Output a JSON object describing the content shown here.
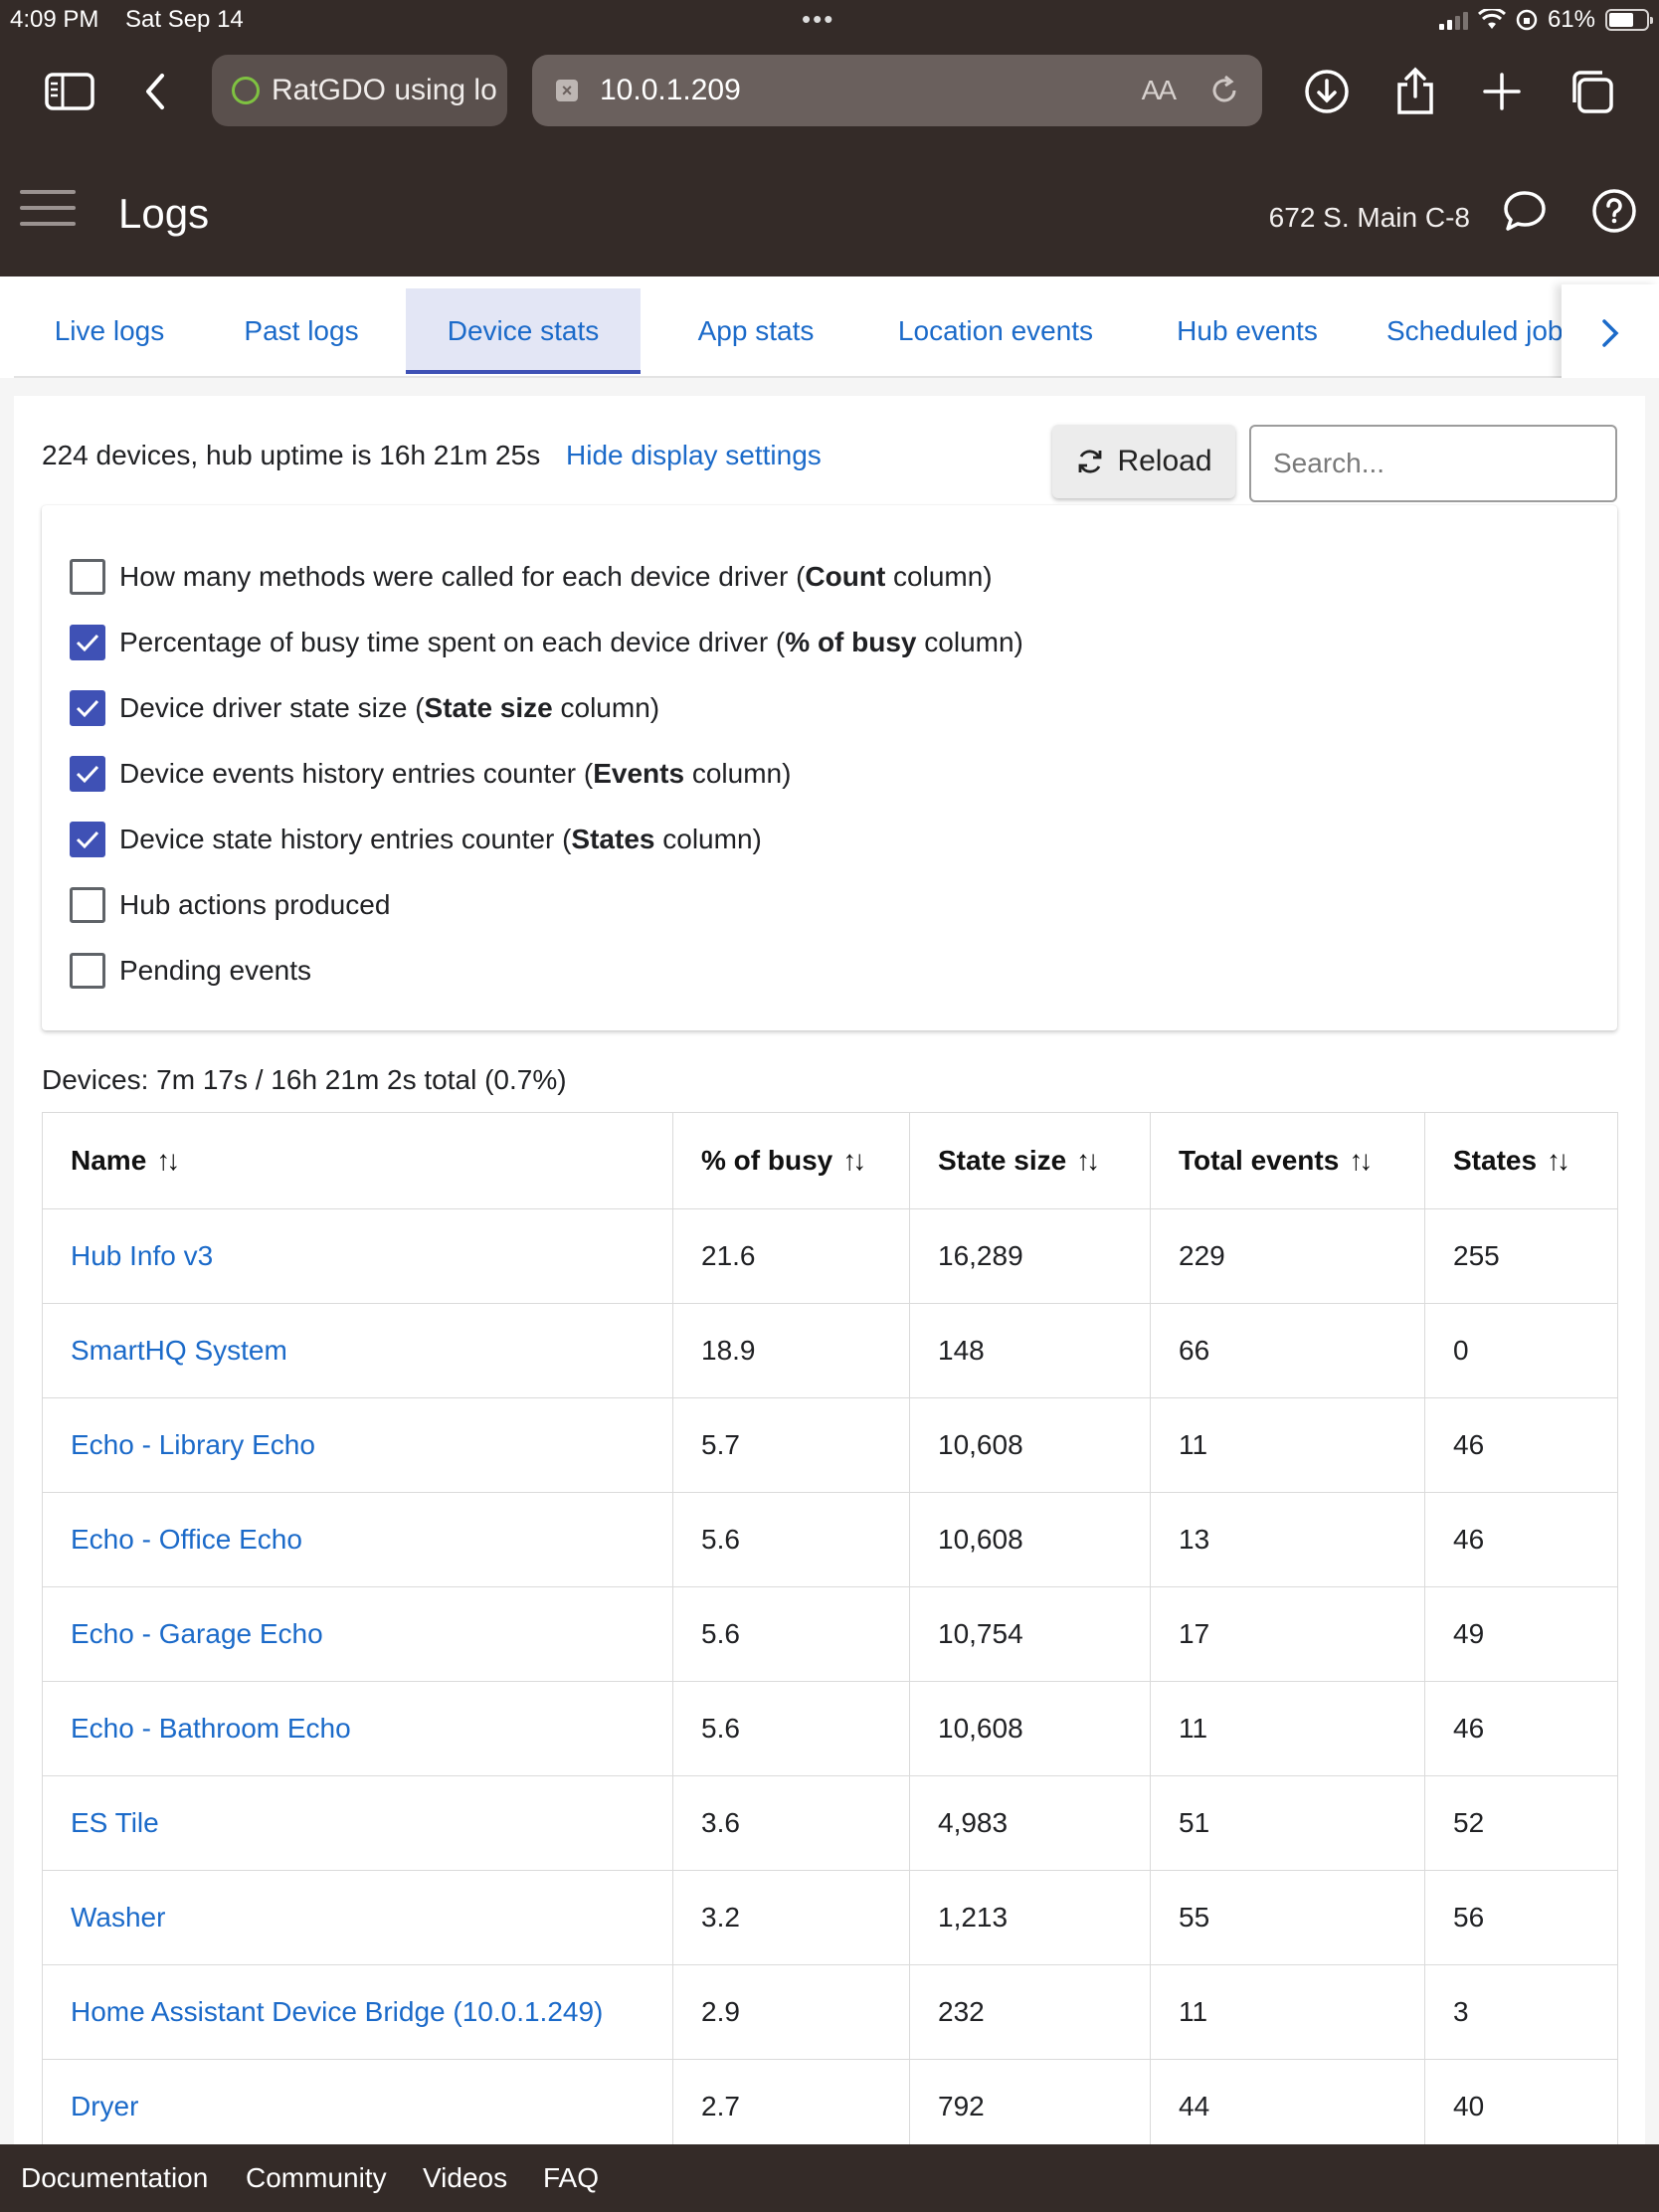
{
  "status_bar": {
    "time": "4:09 PM",
    "date": "Sat Sep 14",
    "battery": "61%"
  },
  "browser": {
    "tab_title": "RatGDO using lo",
    "url": "10.0.1.209",
    "reader_label": "AA"
  },
  "header": {
    "title": "Logs",
    "location": "672 S. Main C-8"
  },
  "tabs": [
    {
      "label": "Live logs"
    },
    {
      "label": "Past logs"
    },
    {
      "label": "Device stats",
      "active": true
    },
    {
      "label": "App stats"
    },
    {
      "label": "Location events"
    },
    {
      "label": "Hub events"
    },
    {
      "label": "Scheduled job"
    }
  ],
  "toolbar": {
    "summary": "224 devices, hub uptime is 16h 21m 25s",
    "hide_settings": "Hide display settings",
    "reload_label": "Reload",
    "search_placeholder": "Search..."
  },
  "settings": [
    {
      "checked": false,
      "pre": "How many methods were called for each device driver (",
      "bold": "Count",
      "post": " column)"
    },
    {
      "checked": true,
      "pre": "Percentage of busy time spent on each device driver (",
      "bold": "% of busy",
      "post": " column)"
    },
    {
      "checked": true,
      "pre": "Device driver state size (",
      "bold": "State size",
      "post": " column)"
    },
    {
      "checked": true,
      "pre": "Device events history entries counter (",
      "bold": "Events",
      "post": " column)"
    },
    {
      "checked": true,
      "pre": "Device state history entries counter (",
      "bold": "States",
      "post": " column)"
    },
    {
      "checked": false,
      "pre": "Hub actions produced",
      "bold": "",
      "post": ""
    },
    {
      "checked": false,
      "pre": "Pending events",
      "bold": "",
      "post": ""
    }
  ],
  "devices_total": "Devices: 7m 17s / 16h 21m 2s total (0.7%)",
  "table": {
    "headers": [
      "Name",
      "% of busy",
      "State size",
      "Total events",
      "States"
    ],
    "sort_glyph": "↑↓",
    "rows": [
      [
        "Hub Info v3",
        "21.6",
        "16,289",
        "229",
        "255"
      ],
      [
        "SmartHQ System",
        "18.9",
        "148",
        "66",
        "0"
      ],
      [
        "Echo - Library Echo",
        "5.7",
        "10,608",
        "11",
        "46"
      ],
      [
        "Echo - Office Echo",
        "5.6",
        "10,608",
        "13",
        "46"
      ],
      [
        "Echo - Garage Echo",
        "5.6",
        "10,754",
        "17",
        "49"
      ],
      [
        "Echo - Bathroom Echo",
        "5.6",
        "10,608",
        "11",
        "46"
      ],
      [
        "ES Tile",
        "3.6",
        "4,983",
        "51",
        "52"
      ],
      [
        "Washer",
        "3.2",
        "1,213",
        "55",
        "56"
      ],
      [
        "Home Assistant Device Bridge (10.0.1.249)",
        "2.9",
        "232",
        "11",
        "3"
      ],
      [
        "Dryer",
        "2.7",
        "792",
        "44",
        "40"
      ]
    ]
  },
  "footer": {
    "links": [
      "Documentation",
      "Community",
      "Videos",
      "FAQ"
    ]
  },
  "colors": {
    "chrome": "#342b28",
    "link": "#1b6ac9",
    "accent": "#3f51b5"
  }
}
